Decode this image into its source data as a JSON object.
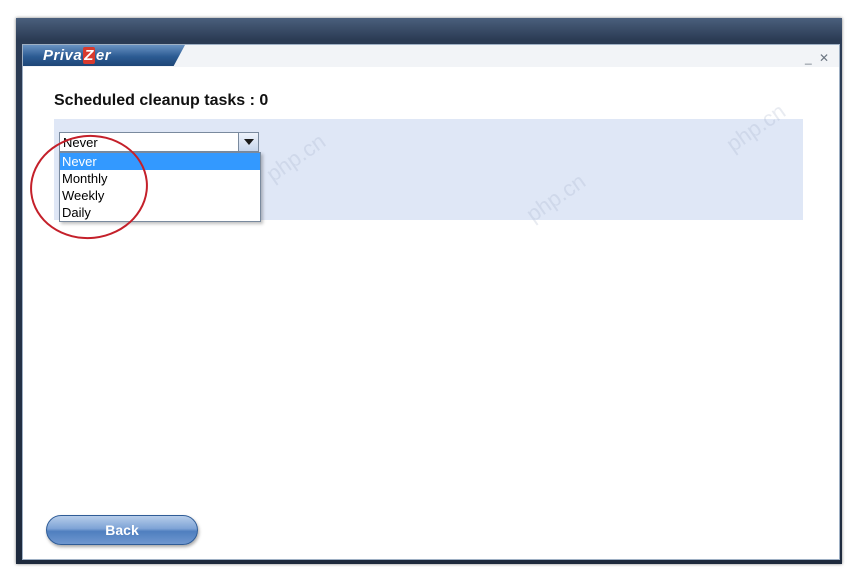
{
  "app": {
    "logo": "PrivaZer",
    "window_controls": "_ ✕"
  },
  "main": {
    "heading": "Scheduled cleanup tasks : 0",
    "schedule_select": {
      "value": "Never",
      "options": [
        "Never",
        "Monthly",
        "Weekly",
        "Daily"
      ]
    },
    "back_label": "Back"
  },
  "watermark": "php.cn",
  "colors": {
    "selection": "#3399ff",
    "panel": "#dfe7f6",
    "annotation": "#c4202a",
    "button": "#4f7fbf"
  },
  "icons": {
    "dropdown_arrow": "chevron-down-icon"
  }
}
